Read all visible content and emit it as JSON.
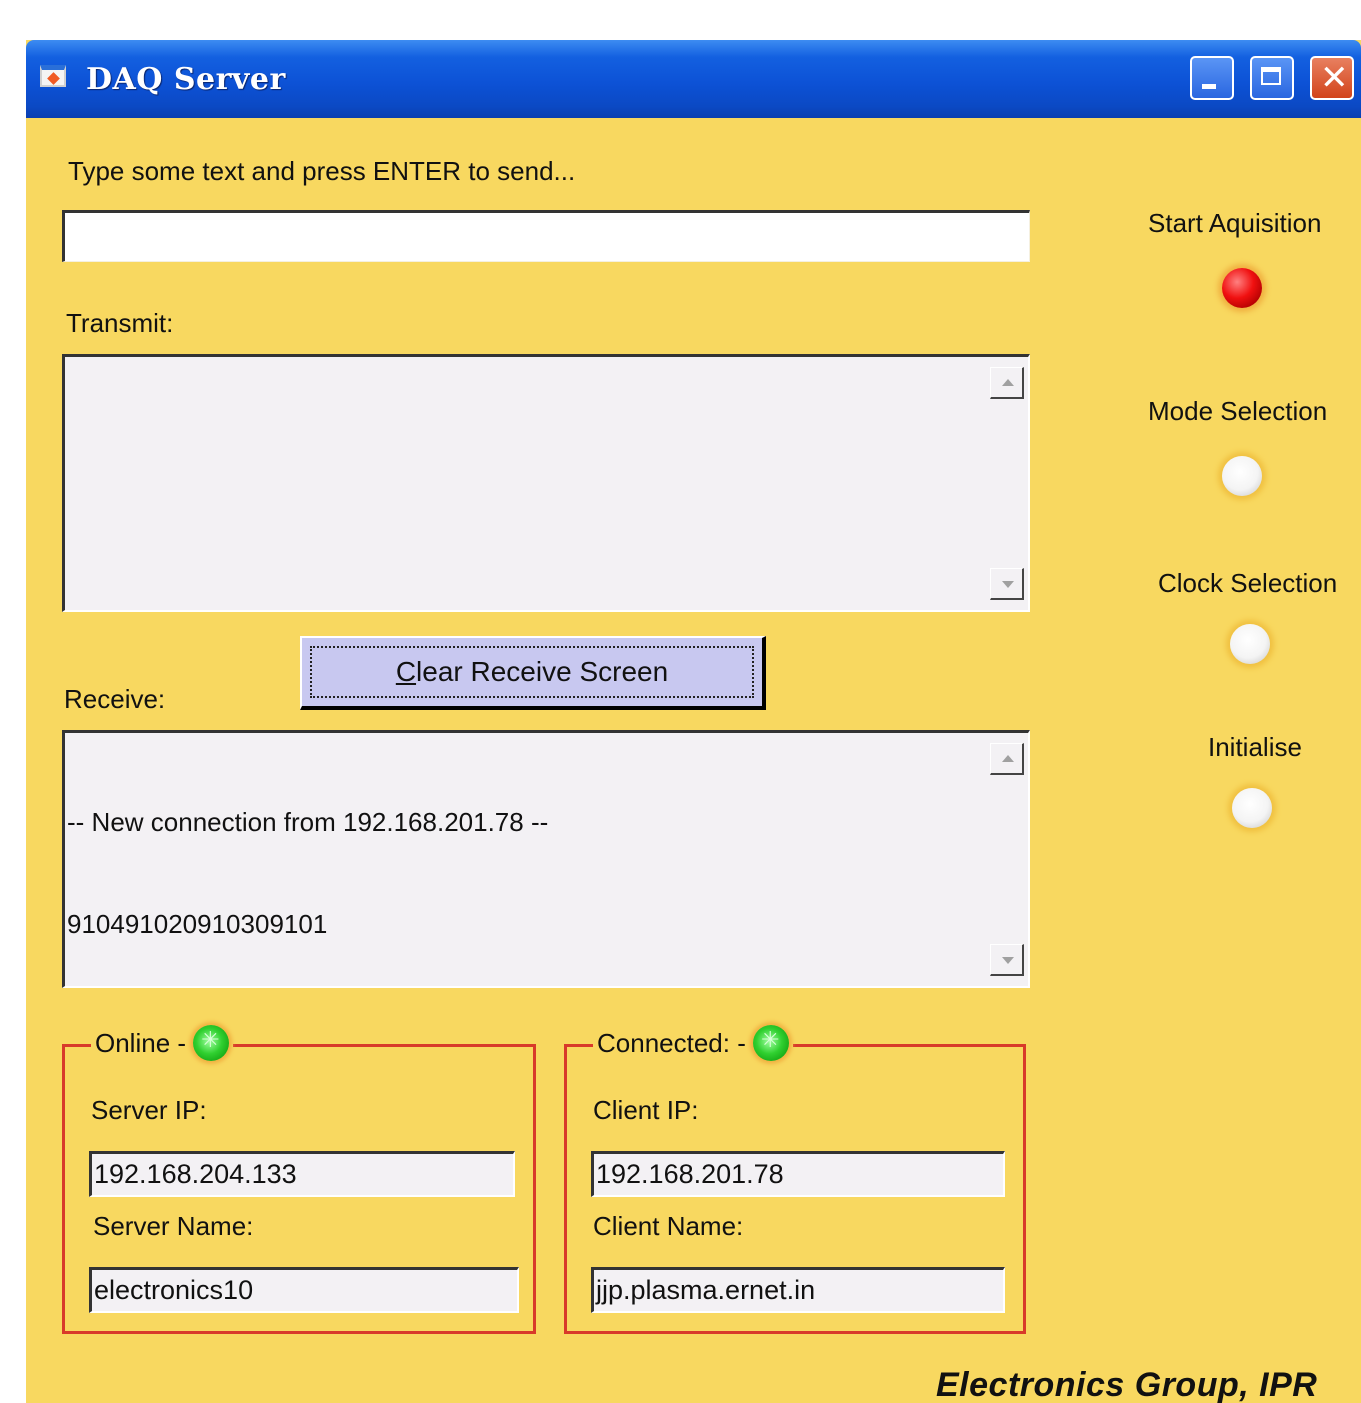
{
  "window": {
    "title": "DAQ Server"
  },
  "send": {
    "prompt_label": "Type some text and press ENTER to send...",
    "input_value": ""
  },
  "transmit": {
    "label": "Transmit:",
    "text": ""
  },
  "receive": {
    "label": "Receive:",
    "clear_button_label": "Clear Receive Screen",
    "clear_button_mnemonic": "C",
    "lines": [
      "-- New connection from 192.168.201.78 --",
      "910491020910309101"
    ]
  },
  "indicators": [
    {
      "label": "Start Aquisition",
      "state": "on",
      "color": "#f01010"
    },
    {
      "label": "Mode Selection",
      "state": "off",
      "color": "#f4f4f4"
    },
    {
      "label": "Clock Selection",
      "state": "off",
      "color": "#f4f4f4"
    },
    {
      "label": "Initialise",
      "state": "off",
      "color": "#f4f4f4"
    }
  ],
  "online": {
    "group_label": "Online",
    "led_state": "on",
    "led_color": "#30d030",
    "server_ip_label": "Server IP:",
    "server_ip": "192.168.204.133",
    "server_name_label": "Server Name:",
    "server_name": "electronics10"
  },
  "connected": {
    "group_label": "Connected:",
    "led_state": "on",
    "led_color": "#30d030",
    "client_ip_label": "Client IP:",
    "client_ip": "192.168.201.78",
    "client_name_label": "Client Name:",
    "client_name": "jjp.plasma.ernet.in"
  },
  "footer": {
    "credit": "Electronics Group, IPR"
  },
  "colors": {
    "window_bg": "#f8d860",
    "titlebar": "#0d52d6",
    "group_border": "#d83a2a",
    "button_bg": "#c8c8f0"
  }
}
